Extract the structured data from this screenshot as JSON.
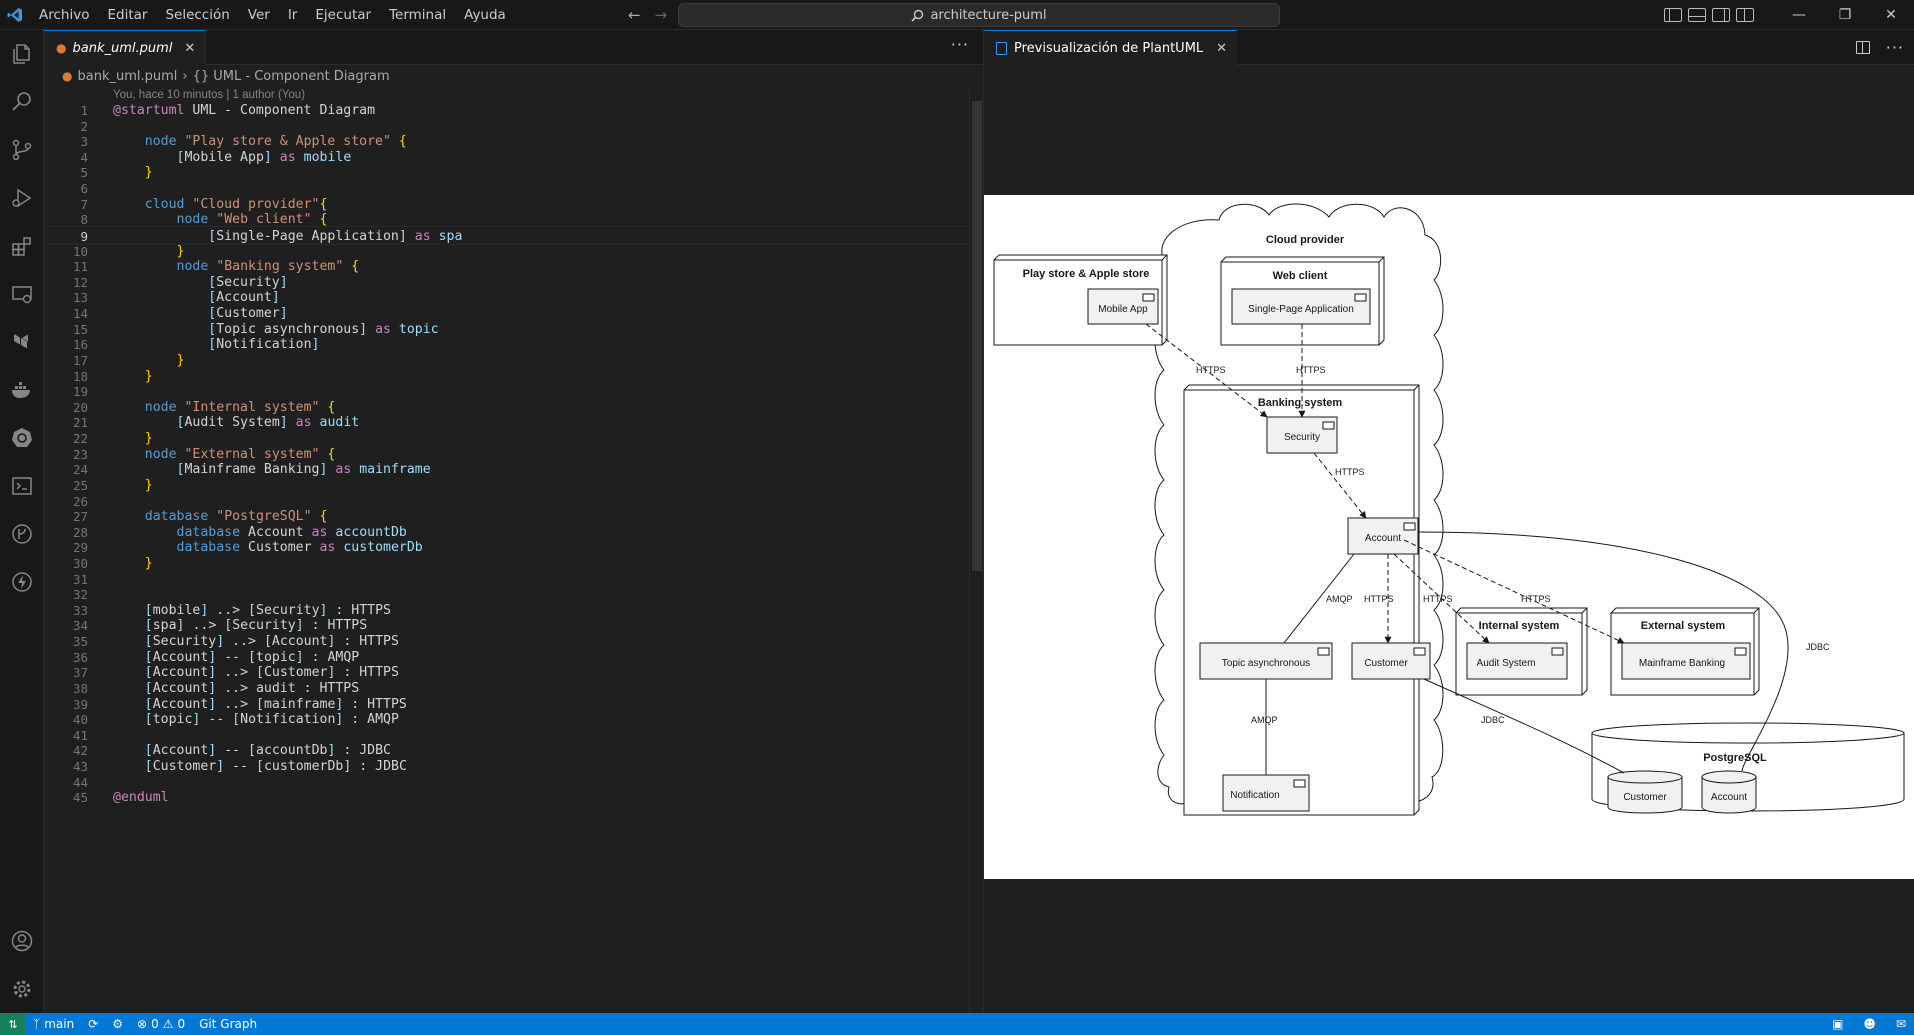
{
  "titlebar": {
    "menu": [
      "Archivo",
      "Editar",
      "Selección",
      "Ver",
      "Ir",
      "Ejecutar",
      "Terminal",
      "Ayuda"
    ],
    "search_text": "architecture-puml"
  },
  "activity_icons": [
    "explorer-icon",
    "search-icon",
    "source-control-icon",
    "run-debug-icon",
    "extensions-icon",
    "remote-explorer-icon",
    "terraform-icon",
    "docker-icon",
    "kubernetes-icon",
    "terminal-icon",
    "gitlens-icon",
    "thunder-icon",
    "accounts-icon",
    "settings-gear-icon"
  ],
  "editor": {
    "tab_label": "bank_uml.puml",
    "breadcrumb_file": "bank_uml.puml",
    "breadcrumb_symbol": "{} UML - Component Diagram",
    "blame": "You, hace 10 minutos | 1 author (You)",
    "current_line": 9
  },
  "code_lines": [
    "@startuml UML - Component Diagram",
    "",
    "    node \"Play store & Apple store\" {",
    "        [Mobile App] as mobile",
    "    }",
    "",
    "    cloud \"Cloud provider\"{",
    "        node \"Web client\" {",
    "            [Single-Page Application] as spa",
    "        }",
    "        node \"Banking system\" {",
    "            [Security]",
    "            [Account]",
    "            [Customer]",
    "            [Topic asynchronous] as topic",
    "            [Notification]",
    "        }",
    "    }",
    "",
    "    node \"Internal system\" {",
    "        [Audit System] as audit",
    "    }",
    "    node \"External system\" {",
    "        [Mainframe Banking] as mainframe",
    "    }",
    "",
    "    database \"PostgreSQL\" {",
    "        database Account as accountDb",
    "        database Customer as customerDb",
    "    }",
    "",
    "",
    "    [mobile] ..> [Security] : HTTPS",
    "    [spa] ..> [Security] : HTTPS",
    "    [Security] ..> [Account] : HTTPS",
    "    [Account] -- [topic] : AMQP",
    "    [Account] ..> [Customer] : HTTPS",
    "    [Account] ..> audit : HTTPS",
    "    [Account] ..> [mainframe] : HTTPS",
    "    [topic] -- [Notification] : AMQP",
    "",
    "    [Account] -- [accountDb] : JDBC",
    "    [Customer] -- [customerDb] : JDBC",
    "",
    "@enduml"
  ],
  "preview": {
    "tab_label": "Previsualización de PlantUML"
  },
  "diagram": {
    "cloud": "Cloud provider",
    "play_store_node": "Play store & Apple store",
    "mobile_app": "Mobile App",
    "web_client_node": "Web client",
    "spa": "Single-Page Application",
    "banking_node": "Banking system",
    "security": "Security",
    "account": "Account",
    "topic": "Topic asynchronous",
    "customer": "Customer",
    "notification": "Notification",
    "internal_node": "Internal system",
    "audit": "Audit System",
    "external_node": "External system",
    "mainframe": "Mainframe Banking",
    "postgres": "PostgreSQL",
    "customer_db": "Customer",
    "account_db": "Account",
    "https": "HTTPS",
    "amqp": "AMQP",
    "jdbc": "JDBC"
  },
  "statusbar": {
    "branch": "main",
    "errors": "0",
    "warnings": "0",
    "git_graph": "Git Graph"
  },
  "colors": {
    "accent": "#0078d4",
    "remote": "#16825d"
  }
}
